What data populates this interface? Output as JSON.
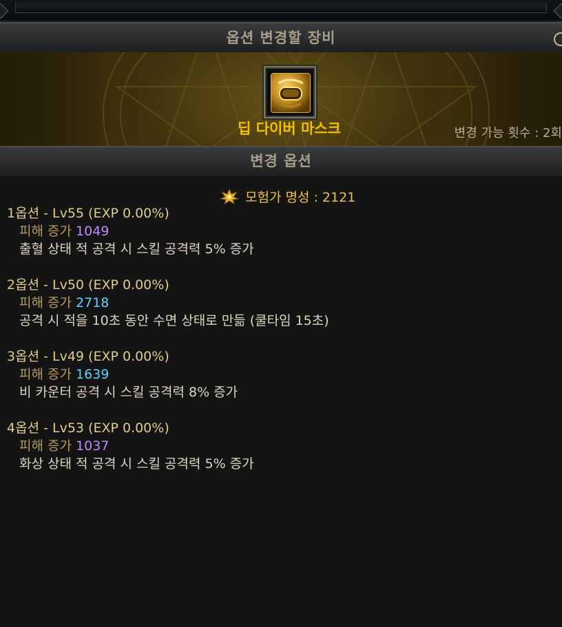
{
  "header": {
    "title": "옵션 변경할 장비"
  },
  "equipment": {
    "icon": "diver-mask-icon",
    "name": "딥 다이버 마스크",
    "change_count_label": "변경 가능 횟수 : 2회"
  },
  "change_section": {
    "title": "변경 옵션"
  },
  "fame": {
    "icon": "adventurer-fame-icon",
    "label": "모험가 명성 : 2121"
  },
  "options": [
    {
      "title": "1옵션 - Lv55 (EXP 0.00%)",
      "damage_label": "피해 증가",
      "damage_value": "1049",
      "value_color": "#b98cff",
      "description": "출혈 상태 적 공격 시 스킬 공격력 5% 증가"
    },
    {
      "title": "2옵션 - Lv50 (EXP 0.00%)",
      "damage_label": "피해 증가",
      "damage_value": "2718",
      "value_color": "#5fd3ff",
      "description": "공격 시 적을 10초 동안 수면 상태로 만듦 (쿨타임 15초)"
    },
    {
      "title": "3옵션 - Lv49 (EXP 0.00%)",
      "damage_label": "피해 증가",
      "damage_value": "1639",
      "value_color": "#5fd3ff",
      "description": "비 카운터 공격 시 스킬 공격력 8% 증가"
    },
    {
      "title": "4옵션 - Lv53 (EXP 0.00%)",
      "damage_label": "피해 증가",
      "damage_value": "1037",
      "value_color": "#b98cff",
      "description": "화상 상태 적 공격 시 스킬 공격력 5% 증가"
    }
  ]
}
